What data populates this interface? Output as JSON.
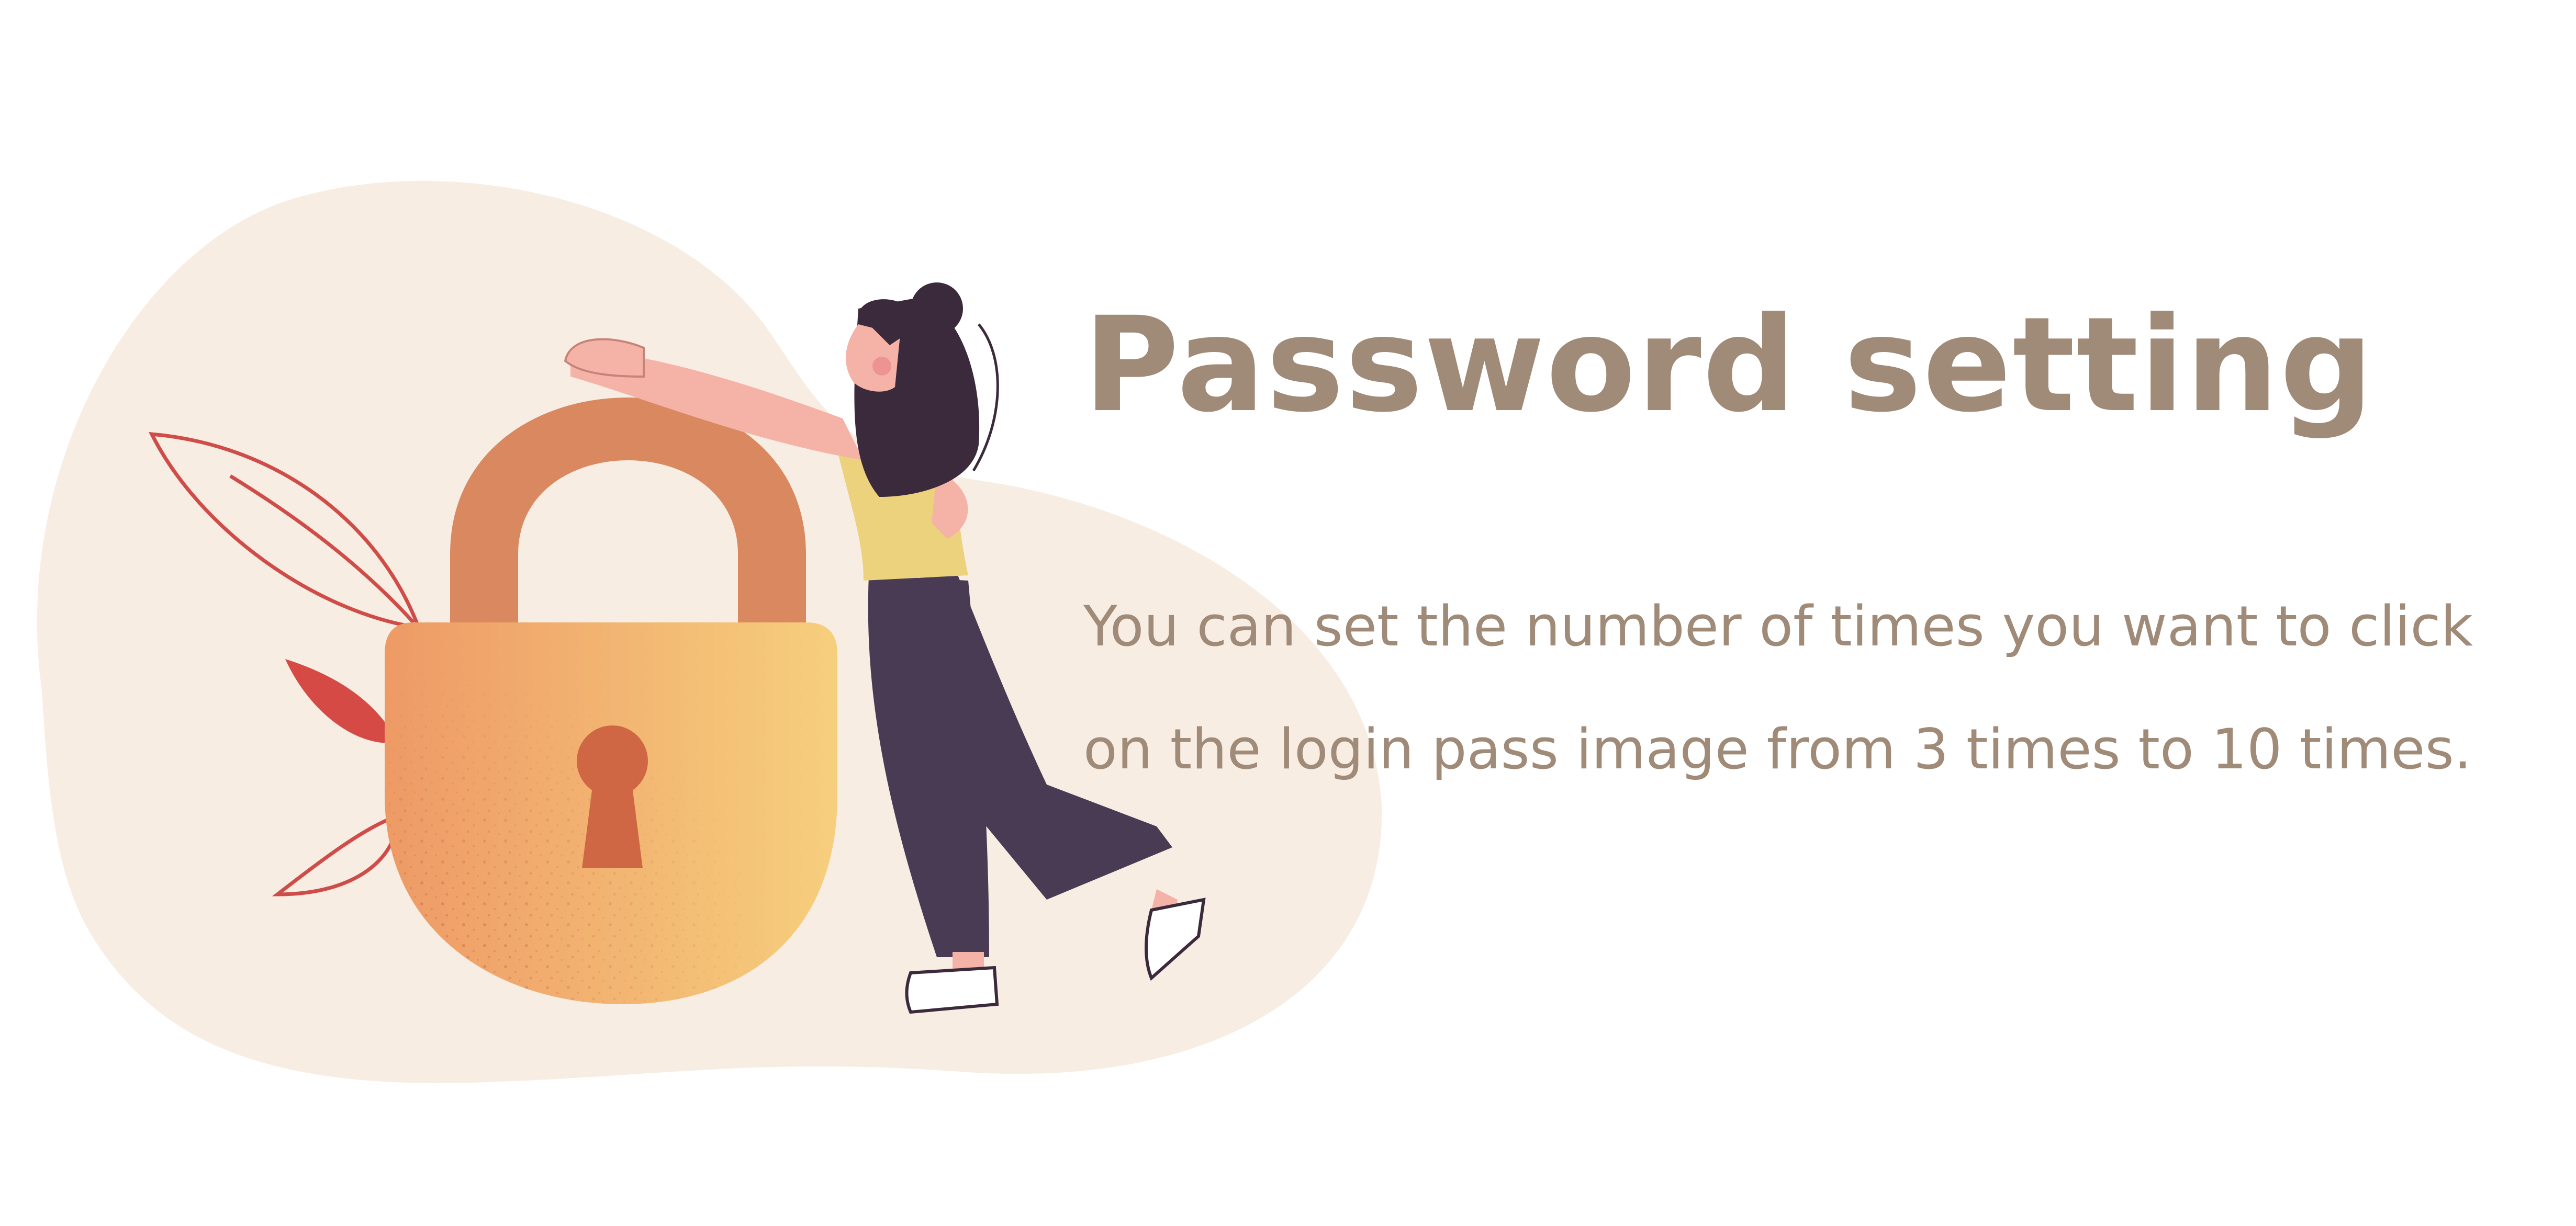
{
  "heading": {
    "title": "Password setting"
  },
  "description": {
    "line1": "You can set the number of times you want to click",
    "line2": "on the login pass image from 3 times to 10 times."
  },
  "colors": {
    "text": "#a08a78",
    "blob": "#f8ede2",
    "shackle": "#d98860",
    "lock_body_left": "#ee9a66",
    "lock_body_right": "#f6cf7d",
    "keyhole": "#cf6644",
    "hair": "#3a2a3b",
    "pants": "#4a3b55",
    "top": "#ecd27c",
    "skin": "#f5b3a8",
    "leaf_red": "#d54a45",
    "leaf_outline": "#cf4c48"
  },
  "icons": {
    "illustration": "woman-holding-padlock-illustration",
    "padlock": "padlock-icon",
    "keyhole": "keyhole-icon",
    "leaves": "leaf-icon"
  }
}
